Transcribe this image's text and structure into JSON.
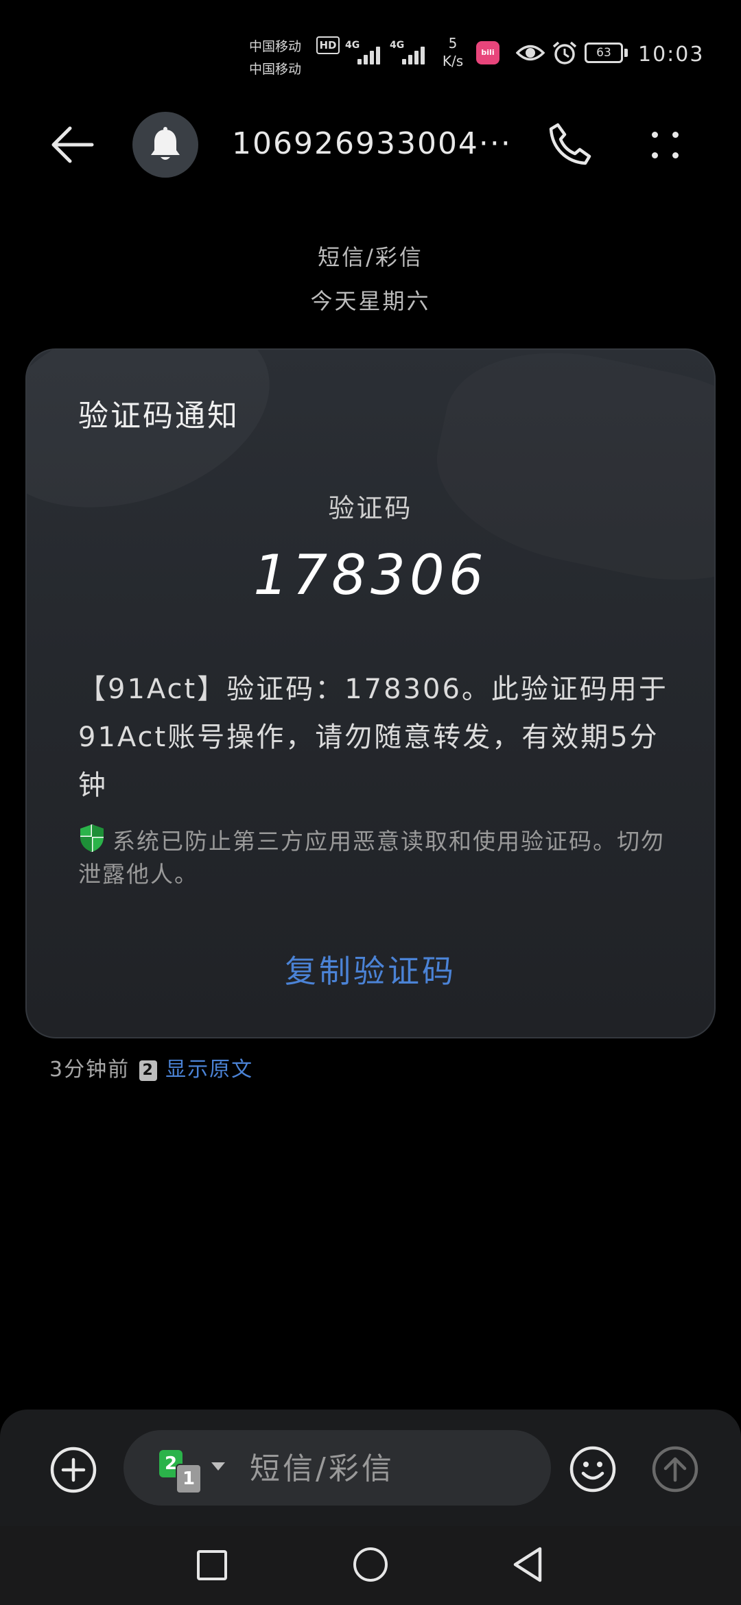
{
  "status_bar": {
    "carrier_1": "中国移动",
    "carrier_2": "中国移动",
    "hd": "HD",
    "network_1": "4G",
    "network_2": "4G",
    "net_speed_value": "5",
    "net_speed_unit": "K/s",
    "battery": "63",
    "time": "10:03"
  },
  "header": {
    "sender": "106926933004···"
  },
  "thread": {
    "message_type": "短信/彩信",
    "date_label": "今天星期六"
  },
  "card": {
    "title": "验证码通知",
    "code_label": "验证码",
    "code": "178306",
    "body": "【91Act】验证码：178306。此验证码用于91Act账号操作，请勿随意转发，有效期5分钟",
    "security_notice": "系统已防止第三方应用恶意读取和使用验证码。切勿泄露他人。",
    "copy_button": "复制验证码"
  },
  "meta": {
    "time_ago": "3分钟前",
    "sim_slot": "2",
    "show_original": "显示原文"
  },
  "composer": {
    "placeholder": "短信/彩信",
    "sim_primary": "2",
    "sim_secondary": "1"
  },
  "colors": {
    "accent": "#4b83d6",
    "shield": "#2bb34a",
    "background": "#000000",
    "card": "#25282d"
  }
}
